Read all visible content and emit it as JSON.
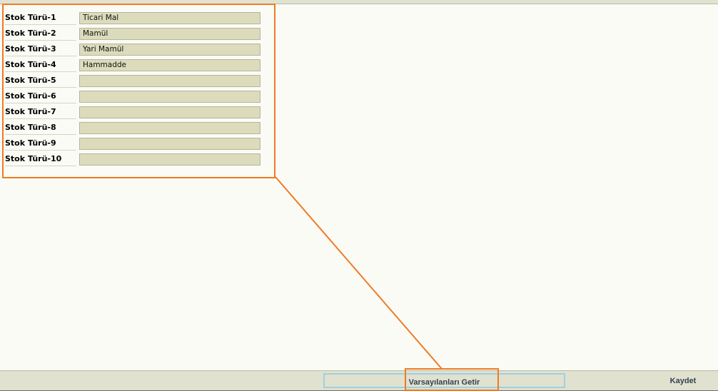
{
  "stock_types": [
    {
      "label": "Stok Türü-1",
      "value": "Ticari Mal"
    },
    {
      "label": "Stok Türü-2",
      "value": "Mamül"
    },
    {
      "label": "Stok Türü-3",
      "value": "Yari Mamül"
    },
    {
      "label": "Stok Türü-4",
      "value": "Hammadde"
    },
    {
      "label": "Stok Türü-5",
      "value": ""
    },
    {
      "label": "Stok Türü-6",
      "value": ""
    },
    {
      "label": "Stok Türü-7",
      "value": ""
    },
    {
      "label": "Stok Türü-8",
      "value": ""
    },
    {
      "label": "Stok Türü-9",
      "value": ""
    },
    {
      "label": "Stok Türü-10",
      "value": ""
    }
  ],
  "footer": {
    "defaults_label": "Varsayılanları Getir",
    "save_label": "Kaydet"
  },
  "colors": {
    "highlight": "#ef7b23",
    "field_bg": "#dcdcbd",
    "page_bg": "#fbfbf6",
    "bar_bg": "#e1e1d0",
    "focus_border": "#9ed0e0"
  }
}
